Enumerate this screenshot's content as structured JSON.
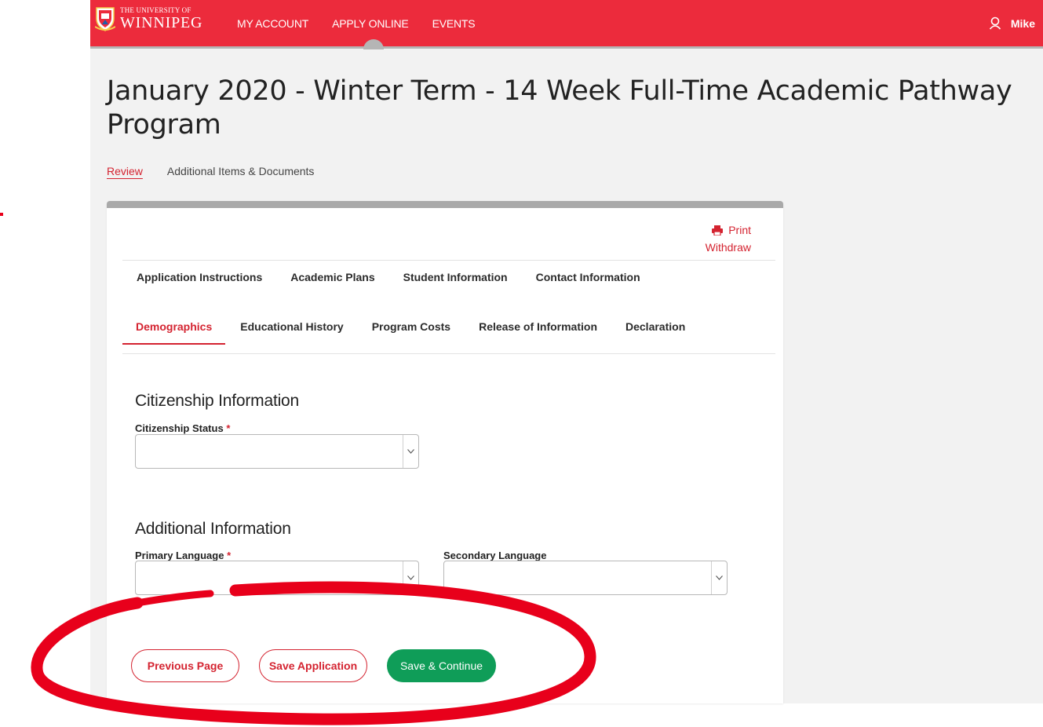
{
  "header": {
    "logo_small": "THE UNIVERSITY OF",
    "logo_big": "WINNIPEG",
    "nav": [
      "MY ACCOUNT",
      "APPLY ONLINE",
      "EVENTS"
    ],
    "user_name": "Mike"
  },
  "title": "January 2020 - Winter Term - 14 Week Full-Time Academic Pathway Program",
  "subtabs": {
    "review": "Review",
    "additional": "Additional Items & Documents"
  },
  "card": {
    "print": "Print",
    "withdraw": "Withdraw",
    "tabs_row1": [
      "Application Instructions",
      "Academic Plans",
      "Student Information",
      "Contact Information"
    ],
    "tabs_row2": [
      "Demographics",
      "Educational History",
      "Program Costs",
      "Release of Information",
      "Declaration"
    ],
    "citizenship": {
      "heading": "Citizenship Information",
      "status_label": "Citizenship Status",
      "required_mark": "*"
    },
    "additional": {
      "heading": "Additional Information",
      "primary_label": "Primary Language",
      "secondary_label": "Secondary Language",
      "required_mark": "*"
    },
    "buttons": {
      "previous": "Previous Page",
      "save": "Save Application",
      "continue": "Save & Continue"
    }
  },
  "colors": {
    "brand_red": "#ec2b3c",
    "accent_red": "#d42330",
    "green": "#0f9d58",
    "annotation_red": "#e8001b"
  }
}
